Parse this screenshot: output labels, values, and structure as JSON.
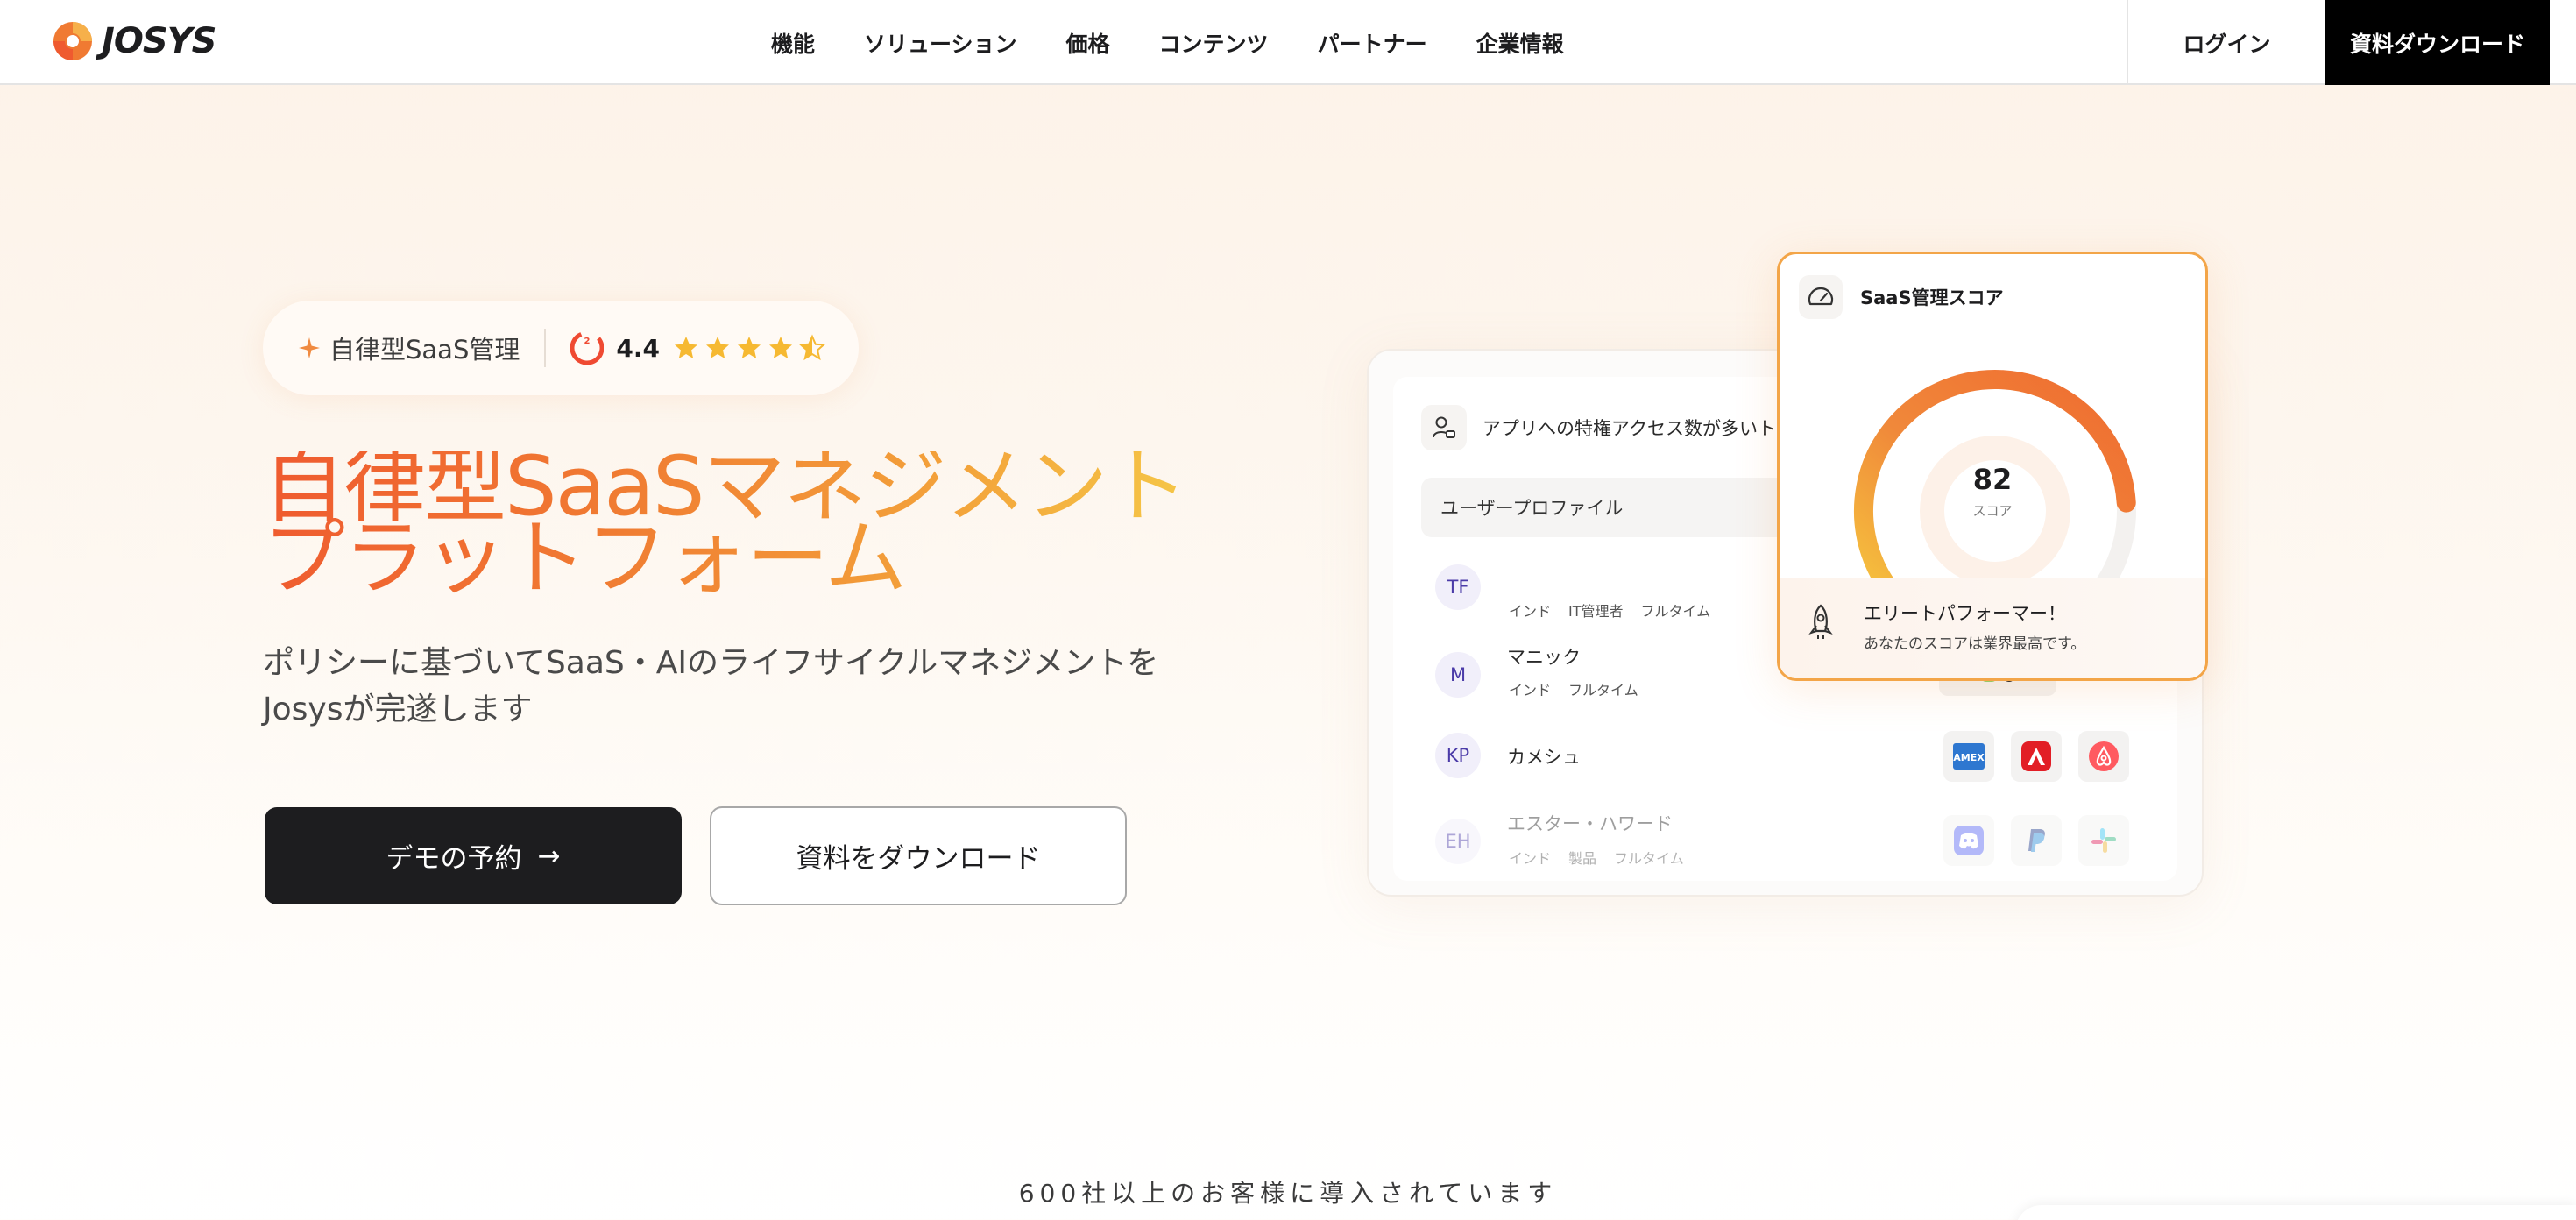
{
  "header": {
    "logo_text": "JOSYS",
    "nav": [
      "機能",
      "ソリューション",
      "価格",
      "コンテンツ",
      "パートナー",
      "企業情報"
    ],
    "login_label": "ログイン",
    "download_label": "資料ダウンロード"
  },
  "hero": {
    "badge_label": "自律型SaaS管理",
    "rating": "4.4",
    "rating_stars": 4.5,
    "headline_line1": "自律型SaaSマネジメント",
    "headline_line2": "プラットフォーム",
    "subline_line1": "ポリシーに基づいてSaaS・AIのライフサイクルマネジメントを",
    "subline_line2": "Josysが完遂します",
    "demo_label": "デモの予約",
    "demo_arrow": "→",
    "download_label": "資料をダウンロード"
  },
  "panel": {
    "alert_text": "アプリへの特権アクセス数が多いト",
    "profile_label": "ユーザープロファイル",
    "users": [
      {
        "initials": "TF",
        "name": "",
        "tags": [
          "インド",
          "IT管理者",
          "フルタイム"
        ]
      },
      {
        "initials": "M",
        "name": "マニック",
        "tags": [
          "インド",
          "フルタイム"
        ]
      },
      {
        "initials": "KP",
        "name": "カメシュ",
        "tags": []
      },
      {
        "initials": "EH",
        "name": "エスター・ハワード",
        "tags": [
          "インド",
          "製品",
          "フルタイム"
        ]
      }
    ],
    "apps_row3": [
      "amex-icon",
      "adobe-icon",
      "airbnb-icon"
    ],
    "apps_row4": [
      "discord-icon",
      "paypal-icon",
      "slack-icon"
    ]
  },
  "score": {
    "title": "SaaS管理スコア",
    "value": "82",
    "unit": "スコア",
    "gauge_fraction": 0.82,
    "elite_title": "エリートパフォーマー！",
    "elite_sub": "あなたのスコアは業界最高です。"
  },
  "customers_text": "600社以上のお客様に導入されています",
  "colors": {
    "accent_orange": "#f07a32",
    "accent_yellow": "#f6cf4a",
    "dark": "#1d1d1f"
  }
}
